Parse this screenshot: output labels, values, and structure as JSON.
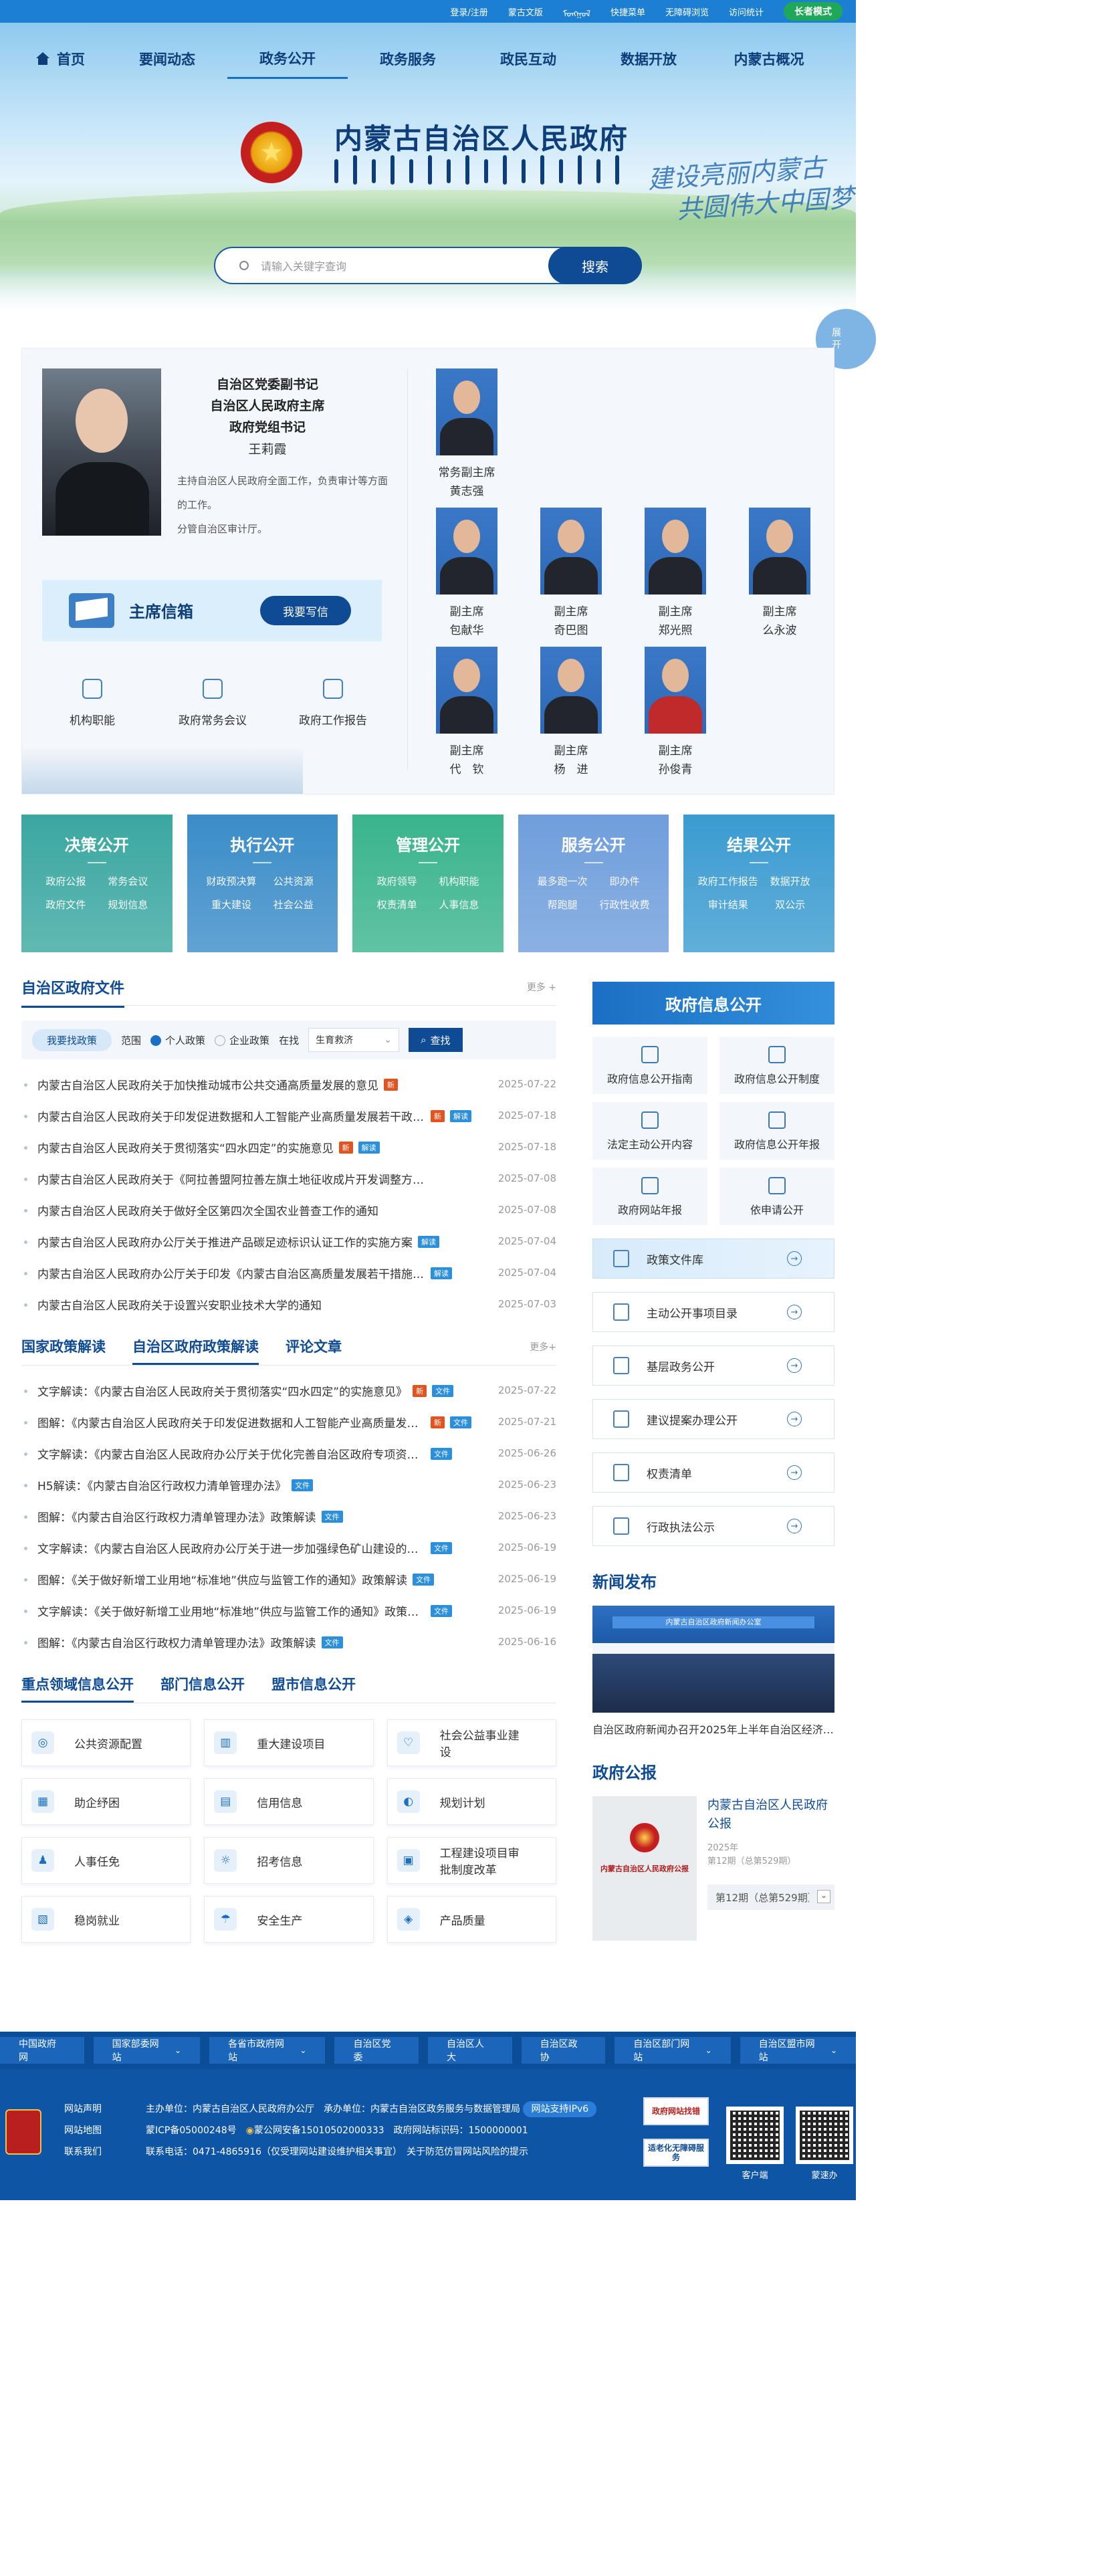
{
  "topbar": {
    "links": [
      "登录/注册",
      "蒙古文版",
      "ᠮᠣᠩᠭᠣᠯ",
      "快捷菜单",
      "无障碍浏览",
      "访问统计"
    ],
    "senior_mode": "长者模式"
  },
  "nav": [
    "首页",
    "要闻动态",
    "政务公开",
    "政务服务",
    "政民互动",
    "数据开放",
    "内蒙古概况"
  ],
  "nav_active_index": 2,
  "site": {
    "name": "内蒙古自治区人民政府",
    "slogan_line1": "建设亮丽内蒙古",
    "slogan_line2": "共圆伟大中国梦"
  },
  "search": {
    "placeholder": "请输入关键字查询",
    "button": "搜索"
  },
  "side_tab": "展开",
  "chief": {
    "title_lines": [
      "自治区党委副书记",
      "自治区人民政府主席",
      "政府党组书记"
    ],
    "name": "王莉霞",
    "duty": "主持自治区人民政府全面工作，负责审计等方面的工作。",
    "duty2": "分管自治区审计厅。"
  },
  "mailbox": {
    "label": "主席信箱",
    "button": "我要写信"
  },
  "quick_links": [
    "机构职能",
    "政府常务会议",
    "政府工作报告"
  ],
  "deputies": [
    {
      "role": "常务副主席",
      "name": "黄志强"
    },
    {
      "role": "副主席",
      "name": "包献华"
    },
    {
      "role": "副主席",
      "name": "奇巴图"
    },
    {
      "role": "副主席",
      "name": "郑光照"
    },
    {
      "role": "副主席",
      "name": "么永波"
    },
    {
      "role": "副主席",
      "name": "代　钦"
    },
    {
      "role": "副主席",
      "name": "杨　进"
    },
    {
      "role": "副主席",
      "name": "孙俊青"
    }
  ],
  "open_cards": [
    {
      "title": "决策公开",
      "items": [
        "政府公报",
        "常务会议",
        "政府文件",
        "规划信息"
      ],
      "color": "#3aa7a0"
    },
    {
      "title": "执行公开",
      "items": [
        "财政预决算",
        "公共资源",
        "重大建设",
        "社会公益"
      ],
      "color": "#3a8cc8"
    },
    {
      "title": "管理公开",
      "items": [
        "政府领导",
        "机构职能",
        "权责清单",
        "人事信息"
      ],
      "color": "#39b48c"
    },
    {
      "title": "服务公开",
      "items": [
        "最多跑一次",
        "即办件",
        "帮跑腿",
        "行政性收费"
      ],
      "color": "#6f9edc"
    },
    {
      "title": "结果公开",
      "items": [
        "政府工作报告",
        "数据开放",
        "审计结果",
        "双公示"
      ],
      "color": "#3a9bd0"
    }
  ],
  "docs": {
    "title": "自治区政府文件",
    "more": "更多 +",
    "filter": {
      "tag": "我要找政策",
      "scope_label": "范围",
      "opt1": "个人政策",
      "opt2": "企业政策",
      "in_label": "在找",
      "select": "生育救济",
      "button": "查找"
    },
    "items": [
      {
        "text": "内蒙古自治区人民政府关于加快推动城市公共交通高质量发展的意见",
        "badges": [
          "新"
        ],
        "date": "2025-07-22"
      },
      {
        "text": "内蒙古自治区人民政府关于印发促进数据和人工智能产业高质量发展若干政策措施的通知",
        "badges": [
          "新",
          "解读"
        ],
        "date": "2025-07-18"
      },
      {
        "text": "内蒙古自治区人民政府关于贯彻落实“四水四定”的实施意见",
        "badges": [
          "新",
          "解读"
        ],
        "date": "2025-07-18"
      },
      {
        "text": "内蒙古自治区人民政府关于《阿拉善盟阿拉善左旗土地征收成片开发调整方案》的批复",
        "badges": [],
        "date": "2025-07-08"
      },
      {
        "text": "内蒙古自治区人民政府关于做好全区第四次全国农业普查工作的通知",
        "badges": [],
        "date": "2025-07-08"
      },
      {
        "text": "内蒙古自治区人民政府办公厅关于推进产品碳足迹标识认证工作的实施方案",
        "badges": [
          "解读"
        ],
        "date": "2025-07-04"
      },
      {
        "text": "内蒙古自治区人民政府办公厅关于印发《内蒙古自治区高质量发展若干措施》的通知",
        "badges": [
          "解读"
        ],
        "date": "2025-07-04"
      },
      {
        "text": "内蒙古自治区人民政府关于设置兴安职业技术大学的通知",
        "badges": [],
        "date": "2025-07-03"
      }
    ]
  },
  "interp": {
    "tabs": [
      "国家政策解读",
      "自治区政府政策解读",
      "评论文章"
    ],
    "more": "更多+",
    "items": [
      {
        "text": "文字解读：《内蒙古自治区人民政府关于贯彻落实“四水四定”的实施意见》",
        "badges": [
          "新",
          "文件"
        ],
        "date": "2025-07-22"
      },
      {
        "text": "图解：《内蒙古自治区人民政府关于印发促进数据和人工智能产业高质量发展若干政策措施》",
        "badges": [
          "新",
          "文件"
        ],
        "date": "2025-07-21"
      },
      {
        "text": "文字解读：《内蒙古自治区人民政府办公厅关于优化完善自治区政府专项资金管理》",
        "badges": [
          "文件"
        ],
        "date": "2025-06-26"
      },
      {
        "text": "H5解读：《内蒙古自治区行政权力清单管理办法》",
        "badges": [
          "文件"
        ],
        "date": "2025-06-23"
      },
      {
        "text": "图解：《内蒙古自治区行政权力清单管理办法》政策解读",
        "badges": [
          "文件"
        ],
        "date": "2025-06-23"
      },
      {
        "text": "文字解读：《内蒙古自治区人民政府办公厅关于进一步加强绿色矿山建设的通知》",
        "badges": [
          "文件"
        ],
        "date": "2025-06-19"
      },
      {
        "text": "图解：《关于做好新增工业用地“标准地”供应与监管工作的通知》政策解读",
        "badges": [
          "文件"
        ],
        "date": "2025-06-19"
      },
      {
        "text": "文字解读：《关于做好新增工业用地“标准地”供应与监管工作的通知》政策解读",
        "badges": [
          "文件"
        ],
        "date": "2025-06-19"
      },
      {
        "text": "图解：《内蒙古自治区行政权力清单管理办法》政策解读",
        "badges": [
          "文件"
        ],
        "date": "2025-06-16"
      }
    ]
  },
  "domain_info": {
    "tabs": [
      "重点领域信息公开",
      "部门信息公开",
      "盟市信息公开"
    ],
    "items": [
      {
        "label": "公共资源配置",
        "icon": "resource-icon"
      },
      {
        "label": "重大建设项目",
        "icon": "project-icon"
      },
      {
        "label": "社会公益事业建设",
        "icon": "heart-icon"
      },
      {
        "label": "助企纾困",
        "icon": "enterprise-icon"
      },
      {
        "label": "信用信息",
        "icon": "credit-icon"
      },
      {
        "label": "规划计划",
        "icon": "plan-icon"
      },
      {
        "label": "人事任免",
        "icon": "person-icon"
      },
      {
        "label": "招考信息",
        "icon": "exam-icon"
      },
      {
        "label": "工程建设项目审批制度改革",
        "icon": "building-icon"
      },
      {
        "label": "稳岗就业",
        "icon": "job-icon"
      },
      {
        "label": "安全生产",
        "icon": "helmet-icon"
      },
      {
        "label": "产品质量",
        "icon": "quality-icon"
      }
    ]
  },
  "gov_info": {
    "title": "政府信息公开",
    "grid": [
      "政府信息公开指南",
      "政府信息公开制度",
      "法定主动公开内容",
      "政府信息公开年报",
      "政府网站年报",
      "依申请公开"
    ],
    "list": [
      "政策文件库",
      "主动公开事项目录",
      "基层政务公开",
      "建议提案办理公开",
      "权责清单",
      "行政执法公示"
    ]
  },
  "news_release": {
    "title": "新闻发布",
    "banner": "内蒙古自治区政府新闻办公室",
    "caption": "自治区政府新闻办召开2025年上半年自治区经济运行情况新闻发布会"
  },
  "gazette": {
    "title": "政府公报",
    "cover_text": "内蒙古自治区人民政府公报",
    "name": "内蒙古自治区人民政府公报",
    "year": "2025年",
    "issue": "第12期（总第529期）",
    "select": "第12期（总第529期）"
  },
  "footer": {
    "links": [
      {
        "label": "中国政府网",
        "dd": false
      },
      {
        "label": "国家部委网站",
        "dd": true
      },
      {
        "label": "各省市政府网站",
        "dd": true
      },
      {
        "label": "自治区党委",
        "dd": false
      },
      {
        "label": "自治区人大",
        "dd": false
      },
      {
        "label": "自治区政协",
        "dd": false
      },
      {
        "label": "自治区部门网站",
        "dd": true
      },
      {
        "label": "自治区盟市网站",
        "dd": true
      }
    ],
    "left_links": [
      "网站声明",
      "网站地图",
      "联系我们"
    ],
    "line1": "主办单位：内蒙古自治区人民政府办公厅　承办单位：内蒙古自治区政务服务与数据管理局",
    "ipv6": "网站支持IPv6",
    "line2a": "蒙ICP备05000248号",
    "line2b": "蒙公网安备15010502000333",
    "line2c": "政府网站标识码：1500000001",
    "line3": "联系电话：0471-4865916（仅受理网站建设维护相关事宜）　关于防范仿冒网站风险的提示",
    "badge1": "政府网站找错",
    "badge2": "适老化无障碍服务",
    "qr1": "客户端",
    "qr2": "蒙速办"
  }
}
